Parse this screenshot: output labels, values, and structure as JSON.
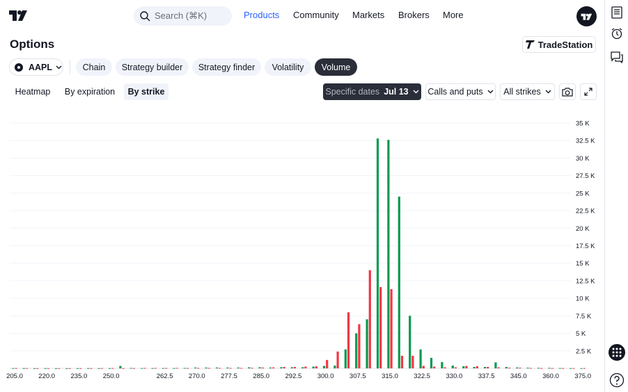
{
  "nav": {
    "search_placeholder": "Search (⌘K)",
    "links": [
      "Products",
      "Community",
      "Markets",
      "Brokers",
      "More"
    ],
    "active": "Products"
  },
  "page": {
    "title": "Options",
    "broker_badge": "TradeStation",
    "symbol": "AAPL",
    "tabs": [
      "Chain",
      "Strategy builder",
      "Strategy finder",
      "Volatility",
      "Volume"
    ],
    "active_tab": "Volume",
    "subtabs": [
      "Heatmap",
      "By expiration",
      "By strike"
    ],
    "active_subtab": "By strike",
    "dates_label": "Specific dates",
    "dates_value": "Jul 13",
    "calls_puts": "Calls and puts",
    "strikes": "All strikes"
  },
  "colors": {
    "calls": "#089950",
    "puts": "#f23645",
    "accent": "#2962ff"
  },
  "chart_data": {
    "type": "bar",
    "ylim": [
      0,
      35000
    ],
    "ytick_labels": [
      "2.5 K",
      "5 K",
      "7.5 K",
      "10 K",
      "12.5 K",
      "15 K",
      "17.5 K",
      "20 K",
      "22.5 K",
      "25 K",
      "27.5 K",
      "30 K",
      "32.5 K",
      "35 K"
    ],
    "xtick_labels": [
      "205.0",
      "220.0",
      "235.0",
      "250.0",
      "262.5",
      "270.0",
      "277.5",
      "285.0",
      "292.5",
      "300.0",
      "307.5",
      "315.0",
      "322.5",
      "330.0",
      "337.5",
      "345.0",
      "360.0",
      "375.0"
    ],
    "strikes": [
      "205.0",
      "210.0",
      "215.0",
      "220.0",
      "225.0",
      "230.0",
      "235.0",
      "240.0",
      "245.0",
      "250.0",
      "252.5",
      "255.0",
      "257.5",
      "260.0",
      "262.5",
      "265.0",
      "267.5",
      "270.0",
      "272.5",
      "275.0",
      "277.5",
      "280.0",
      "282.5",
      "285.0",
      "287.5",
      "290.0",
      "292.5",
      "295.0",
      "297.5",
      "300.0",
      "302.5",
      "305.0",
      "307.5",
      "310.0",
      "312.5",
      "315.0",
      "317.5",
      "320.0",
      "322.5",
      "325.0",
      "327.5",
      "330.0",
      "332.5",
      "335.0",
      "337.5",
      "340.0",
      "342.5",
      "345.0",
      "350.0",
      "355.0",
      "360.0",
      "365.0",
      "370.0",
      "375.0"
    ],
    "series": [
      {
        "values": [
          40,
          30,
          20,
          30,
          20,
          20,
          30,
          30,
          20,
          30,
          350,
          60,
          40,
          40,
          40,
          40,
          60,
          120,
          120,
          120,
          120,
          120,
          150,
          160,
          120,
          160,
          160,
          160,
          250,
          350,
          400,
          2700,
          5000,
          7000,
          32800,
          32600,
          24500,
          7500,
          2700,
          1500,
          900,
          400,
          300,
          200,
          200,
          850,
          200,
          130,
          100,
          80,
          80,
          50,
          30,
          30
        ]
      },
      {
        "values": [
          40,
          40,
          30,
          30,
          30,
          30,
          30,
          30,
          40,
          40,
          30,
          40,
          60,
          60,
          50,
          60,
          50,
          60,
          60,
          60,
          60,
          60,
          80,
          120,
          140,
          200,
          200,
          250,
          300,
          1200,
          2400,
          8000,
          6300,
          14000,
          11600,
          11300,
          1800,
          1800,
          350,
          250,
          150,
          150,
          350,
          300,
          200,
          150,
          100,
          100,
          60,
          40,
          40,
          40,
          40,
          40
        ]
      }
    ]
  }
}
